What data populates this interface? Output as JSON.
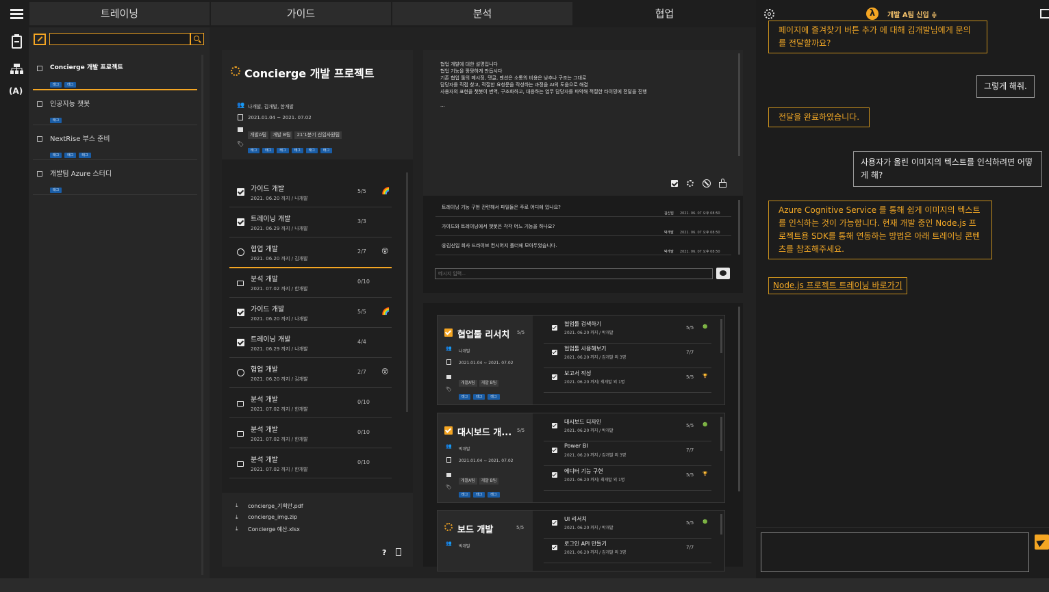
{
  "nav": {
    "tabs": [
      {
        "label": "트레이닝"
      },
      {
        "label": "가이드"
      },
      {
        "label": "분석"
      },
      {
        "label": "협업"
      }
    ],
    "team_selector": "개발 A팀 신입 ≑"
  },
  "sidebar": {
    "icons": [
      "hamburger-icon",
      "clipboard-icon",
      "org-chart-icon",
      "broadcast-icon"
    ]
  },
  "projects": {
    "search_placeholder": "",
    "items": [
      {
        "title": "Concierge 개발 프로젝트",
        "tags": [
          "태그",
          "태그"
        ]
      },
      {
        "title": "인공지능 챗봇",
        "tags": [
          "태그"
        ]
      },
      {
        "title": "NextRise 부스 준비",
        "tags": [
          "태그",
          "태그",
          "태그"
        ]
      },
      {
        "title": "개발팀 Azure 스터디",
        "tags": [
          "태그"
        ]
      }
    ]
  },
  "detail": {
    "title": "Concierge 개발 프로젝트",
    "members": "나개발, 김개발, 한개발",
    "period": "2021.01.04 ~ 2021. 07.02",
    "teams": [
      "개발A팀",
      "개발 B팀",
      "21'1분기 신입사원팀"
    ],
    "tags": [
      "태그",
      "태그",
      "태그",
      "태그",
      "태그",
      "태그"
    ],
    "tasks": [
      {
        "title": "가이드 개발",
        "date": "2021. 06.20 까지 / 나개발",
        "count": "5/5",
        "status": "done",
        "emoji": "🌈"
      },
      {
        "title": "트레이닝 개발",
        "date": "2021. 06.29 까지 / 나개발",
        "count": "3/3",
        "status": "done",
        "emoji": ""
      },
      {
        "title": "협업 개발",
        "date": "2021. 06.20 까지 / 김개발",
        "count": "2/7",
        "status": "play",
        "emoji": "😵"
      },
      {
        "title": "분석 개발",
        "date": "2021. 07.02 까지 / 한개발",
        "count": "0/10",
        "status": "lock",
        "emoji": ""
      },
      {
        "title": "가이드 개발",
        "date": "2021. 06.20 까지 / 나개발",
        "count": "5/5",
        "status": "done",
        "emoji": "🌈"
      },
      {
        "title": "트레이닝 개발",
        "date": "2021. 06.29 까지 / 나개발",
        "count": "4/4",
        "status": "done",
        "emoji": ""
      },
      {
        "title": "협업 개발",
        "date": "2021. 06.20 까지 / 김개발",
        "count": "2/7",
        "status": "play",
        "emoji": "😵"
      },
      {
        "title": "분석 개발",
        "date": "2021. 07.02 까지 / 한개발",
        "count": "0/10",
        "status": "lock",
        "emoji": ""
      },
      {
        "title": "분석 개발",
        "date": "2021. 07.02 까지 / 한개발",
        "count": "0/10",
        "status": "lock",
        "emoji": ""
      },
      {
        "title": "분석 개발",
        "date": "2021. 07.02 까지 / 한개발",
        "count": "0/10",
        "status": "lock",
        "emoji": ""
      }
    ],
    "files": [
      "concierge_기획안.pdf",
      "concierge_img.zip",
      "Concierge 예산.xlsx"
    ],
    "help": "?"
  },
  "description": {
    "lines": [
      "협업 개발에 대한 설명입니다",
      "협업 기능을 팡팡하게 만듭시다",
      "기존 협업 툴의 메시징, 댓글, 멘션은 소통의 비용은 낮추나 구조는 그대로",
      "담당자를 직접 찾고, 적절한 요청문을 작성하는 과정을 AI의 도움으로 해결",
      "사용자의 표현을 챗봇이 번역, 구조화하고, 대응하는 업무 담당자를 파악해 적절한 타이밍에 전달을 진행",
      "",
      "..."
    ]
  },
  "comments": {
    "items": [
      {
        "text": "트레이닝 기능 구현 관련해서 파일들은 주로 어디에 있나요?",
        "author": "김신입",
        "time": "2021. 06. 07 오후 08:50"
      },
      {
        "text": "가이드와 트레이닝에서 챗봇은 각각 어느 기능을 하나요?",
        "author": "박개발",
        "time": "2021. 06. 07 오후 08:50"
      },
      {
        "text": "@김신입 회사 드라이브 컨시어지 폴더에 모아두었습니다.",
        "author": "박개발",
        "time": "2021. 06. 07 오후 08:50"
      }
    ],
    "input_placeholder": "메시지 입력..."
  },
  "subprojects": [
    {
      "title": "협업툴 리서치",
      "count": "5/5",
      "member": "나개발",
      "period": "2021.01.04 ~ 2021. 07.02",
      "teams": [
        "개발A팀",
        "개발 B팀"
      ],
      "tags": [
        "태그",
        "태그",
        "태그"
      ],
      "icon": "check",
      "tasks": [
        {
          "title": "협업툴 검색하기",
          "date": "2021. 06.20 까지 / 박개발",
          "count": "5/5",
          "emoji": "🟢"
        },
        {
          "title": "협업툴 사용해보기",
          "date": "2021. 06.20 까지 / 김개발 외 3명",
          "count": "7/7",
          "emoji": ""
        },
        {
          "title": "보고서 작성",
          "date": "2021. 06.20 까지/ 최개발 외 1명",
          "count": "5/5",
          "emoji": "🏆"
        }
      ]
    },
    {
      "title": "대시보드 개...",
      "count": "5/5",
      "member": "박개발",
      "period": "2021.01.04 ~ 2021. 07.02",
      "teams": [
        "개발A팀",
        "개발 B팀"
      ],
      "tags": [
        "태그",
        "태그",
        "태그"
      ],
      "icon": "check",
      "tasks": [
        {
          "title": "대시보드 디자인",
          "date": "2021. 06.20 까지 / 박개발",
          "count": "5/5",
          "emoji": "🟢"
        },
        {
          "title": "Power BI",
          "date": "2021. 06.20 까지 / 김개발 외 3명",
          "count": "7/7",
          "emoji": ""
        },
        {
          "title": "에디터 기능 구현",
          "date": "2021. 06.20 까지/ 최개발 외 1명",
          "count": "5/5",
          "emoji": "🏆"
        }
      ]
    },
    {
      "title": "보드 개발",
      "count": "5/5",
      "member": "박개발",
      "icon": "spinner",
      "tasks": [
        {
          "title": "UI 리서치",
          "date": "2021. 06.20 까지 / 박개발",
          "count": "5/5",
          "emoji": "🟢"
        },
        {
          "title": "로그인 API 만들기",
          "date": "2021. 06.20 까지 / 김개발 외 3명",
          "count": "7/7",
          "emoji": ""
        }
      ]
    }
  ],
  "chat": {
    "messages": [
      {
        "from": "bot",
        "text": "페이지에 즐겨찾기 버튼 추가 에 대해 김개발님에게 문의를 전달할까요?"
      },
      {
        "from": "user",
        "text": "그렇게 해줘."
      },
      {
        "from": "bot",
        "text": "전달을 완료하였습니다."
      },
      {
        "from": "user",
        "text": "사용자가 올린 이미지의 텍스트를 인식하려면 어떻게 해?"
      },
      {
        "from": "bot",
        "text": "Azure Cognitive Service 를 통해 쉽게 이미지의 텍스트를 인식하는 것이 가능합니다. 현재 개발 중인 Node.js 프로젝트용 SDK를 통해 연동하는 방법은 아래 트레이닝 콘텐츠를 참조해주세요."
      },
      {
        "from": "bot-link",
        "text": "Node.js 프로젝트 트레이닝 바로가기"
      }
    ],
    "input_placeholder": ""
  },
  "colors": {
    "accent": "#f5a623",
    "tag": "#1a5da6",
    "bg": "#222222",
    "panel": "#262626"
  }
}
